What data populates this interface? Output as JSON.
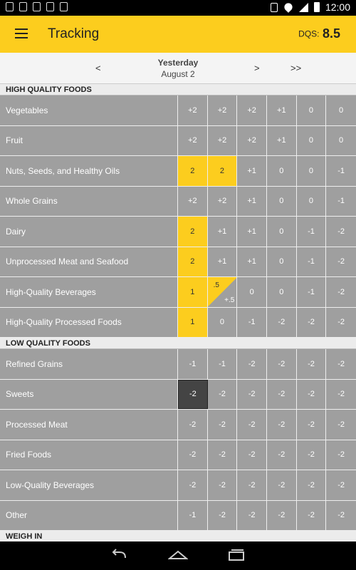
{
  "status": {
    "time": "12:00"
  },
  "appbar": {
    "title": "Tracking",
    "dqs_label": "DQS:",
    "dqs_value": "8.5"
  },
  "date_nav": {
    "prev": "<",
    "day": "Yesterday",
    "date": "August 2",
    "next": ">",
    "last": ">>"
  },
  "sections": [
    {
      "title": "HIGH QUALITY FOODS",
      "rows": [
        {
          "name": "Vegetables",
          "cells": [
            {
              "v": "+2"
            },
            {
              "v": "+2"
            },
            {
              "v": "+2"
            },
            {
              "v": "+1"
            },
            {
              "v": "0"
            },
            {
              "v": "0"
            }
          ]
        },
        {
          "name": "Fruit",
          "cells": [
            {
              "v": "+2"
            },
            {
              "v": "+2"
            },
            {
              "v": "+2"
            },
            {
              "v": "+1"
            },
            {
              "v": "0"
            },
            {
              "v": "0"
            }
          ]
        },
        {
          "name": "Nuts, Seeds, and Healthy Oils",
          "cells": [
            {
              "v": "2",
              "state": "filled"
            },
            {
              "v": "2",
              "state": "filled"
            },
            {
              "v": "+1"
            },
            {
              "v": "0"
            },
            {
              "v": "0"
            },
            {
              "v": "-1"
            }
          ]
        },
        {
          "name": "Whole Grains",
          "cells": [
            {
              "v": "+2"
            },
            {
              "v": "+2"
            },
            {
              "v": "+1"
            },
            {
              "v": "0"
            },
            {
              "v": "0"
            },
            {
              "v": "-1"
            }
          ]
        },
        {
          "name": "Dairy",
          "cells": [
            {
              "v": "2",
              "state": "filled"
            },
            {
              "v": "+1"
            },
            {
              "v": "+1"
            },
            {
              "v": "0"
            },
            {
              "v": "-1"
            },
            {
              "v": "-2"
            }
          ]
        },
        {
          "name": "Unprocessed Meat and Seafood",
          "cells": [
            {
              "v": "2",
              "state": "filled"
            },
            {
              "v": "+1"
            },
            {
              "v": "+1"
            },
            {
              "v": "0"
            },
            {
              "v": "-1"
            },
            {
              "v": "-2"
            }
          ]
        },
        {
          "name": "High-Quality Beverages",
          "cells": [
            {
              "v": "1",
              "state": "filled"
            },
            {
              "v": ".5",
              "v2": "+.5",
              "state": "half"
            },
            {
              "v": "0"
            },
            {
              "v": "0"
            },
            {
              "v": "-1"
            },
            {
              "v": "-2"
            }
          ]
        },
        {
          "name": "High-Quality Processed Foods",
          "cells": [
            {
              "v": "1",
              "state": "filled"
            },
            {
              "v": "0"
            },
            {
              "v": "-1"
            },
            {
              "v": "-2"
            },
            {
              "v": "-2"
            },
            {
              "v": "-2"
            }
          ]
        }
      ]
    },
    {
      "title": "LOW QUALITY FOODS",
      "rows": [
        {
          "name": "Refined Grains",
          "cells": [
            {
              "v": "-1"
            },
            {
              "v": "-1"
            },
            {
              "v": "-2"
            },
            {
              "v": "-2"
            },
            {
              "v": "-2"
            },
            {
              "v": "-2"
            }
          ]
        },
        {
          "name": "Sweets",
          "cells": [
            {
              "v": "-2",
              "state": "selected"
            },
            {
              "v": "-2"
            },
            {
              "v": "-2"
            },
            {
              "v": "-2"
            },
            {
              "v": "-2"
            },
            {
              "v": "-2"
            }
          ]
        },
        {
          "name": "Processed Meat",
          "cells": [
            {
              "v": "-2"
            },
            {
              "v": "-2"
            },
            {
              "v": "-2"
            },
            {
              "v": "-2"
            },
            {
              "v": "-2"
            },
            {
              "v": "-2"
            }
          ]
        },
        {
          "name": "Fried Foods",
          "cells": [
            {
              "v": "-2"
            },
            {
              "v": "-2"
            },
            {
              "v": "-2"
            },
            {
              "v": "-2"
            },
            {
              "v": "-2"
            },
            {
              "v": "-2"
            }
          ]
        },
        {
          "name": "Low-Quality Beverages",
          "cells": [
            {
              "v": "-2"
            },
            {
              "v": "-2"
            },
            {
              "v": "-2"
            },
            {
              "v": "-2"
            },
            {
              "v": "-2"
            },
            {
              "v": "-2"
            }
          ]
        },
        {
          "name": "Other",
          "cells": [
            {
              "v": "-1"
            },
            {
              "v": "-2"
            },
            {
              "v": "-2"
            },
            {
              "v": "-2"
            },
            {
              "v": "-2"
            },
            {
              "v": "-2"
            }
          ]
        }
      ]
    },
    {
      "title": "WEIGH IN",
      "rows": []
    }
  ]
}
